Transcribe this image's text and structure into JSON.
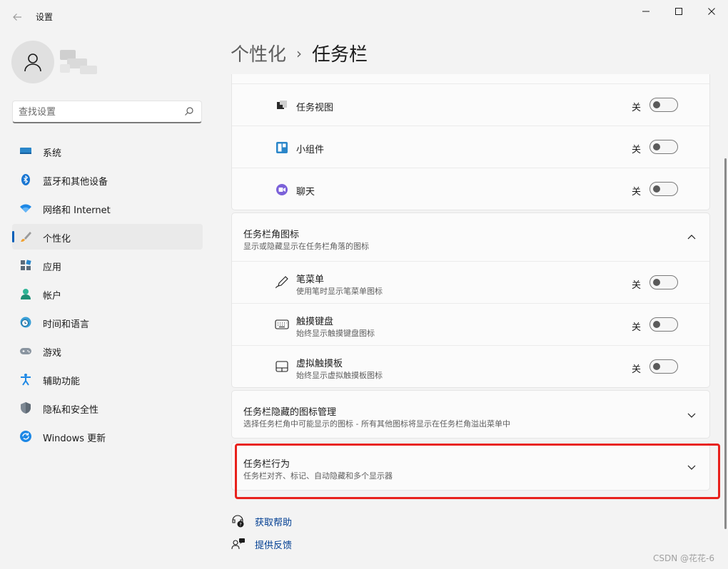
{
  "window": {
    "title": "设置"
  },
  "sidebar": {
    "search_placeholder": "查找设置",
    "items": [
      {
        "label": "系统",
        "icon": "monitor-icon"
      },
      {
        "label": "蓝牙和其他设备",
        "icon": "bluetooth-icon"
      },
      {
        "label": "网络和 Internet",
        "icon": "wifi-icon"
      },
      {
        "label": "个性化",
        "icon": "brush-icon",
        "active": true
      },
      {
        "label": "应用",
        "icon": "apps-icon"
      },
      {
        "label": "帐户",
        "icon": "account-icon"
      },
      {
        "label": "时间和语言",
        "icon": "globe-clock-icon"
      },
      {
        "label": "游戏",
        "icon": "gamepad-icon"
      },
      {
        "label": "辅助功能",
        "icon": "accessibility-icon"
      },
      {
        "label": "隐私和安全性",
        "icon": "shield-icon"
      },
      {
        "label": "Windows 更新",
        "icon": "update-icon"
      }
    ]
  },
  "breadcrumb": {
    "parent": "个性化",
    "separator": "›",
    "current": "任务栏"
  },
  "taskbar_items": {
    "rows": [
      {
        "label": "任务视图",
        "state": "关",
        "icon": "task-view-icon"
      },
      {
        "label": "小组件",
        "state": "关",
        "icon": "widgets-icon"
      },
      {
        "label": "聊天",
        "state": "关",
        "icon": "chat-icon"
      }
    ]
  },
  "corner_icons": {
    "title": "任务栏角图标",
    "subtitle": "显示或隐藏显示在任务栏角落的图标",
    "rows": [
      {
        "label": "笔菜单",
        "sub": "使用笔时显示笔菜单图标",
        "state": "关",
        "icon": "pen-icon"
      },
      {
        "label": "触摸键盘",
        "sub": "始终显示触摸键盘图标",
        "state": "关",
        "icon": "keyboard-icon"
      },
      {
        "label": "虚拟触摸板",
        "sub": "始终显示虚拟触摸板图标",
        "state": "关",
        "icon": "touchpad-icon"
      }
    ]
  },
  "overflow": {
    "title": "任务栏隐藏的图标管理",
    "subtitle": "选择任务栏角中可能显示的图标 - 所有其他图标将显示在任务栏角溢出菜单中"
  },
  "behavior": {
    "title": "任务栏行为",
    "subtitle": "任务栏对齐、标记、自动隐藏和多个显示器"
  },
  "links": {
    "help": "获取帮助",
    "feedback": "提供反馈"
  },
  "watermark": "CSDN @花花-6",
  "colors": {
    "accent": "#005fb8",
    "highlight": "#e8211c",
    "link": "#003e92"
  }
}
